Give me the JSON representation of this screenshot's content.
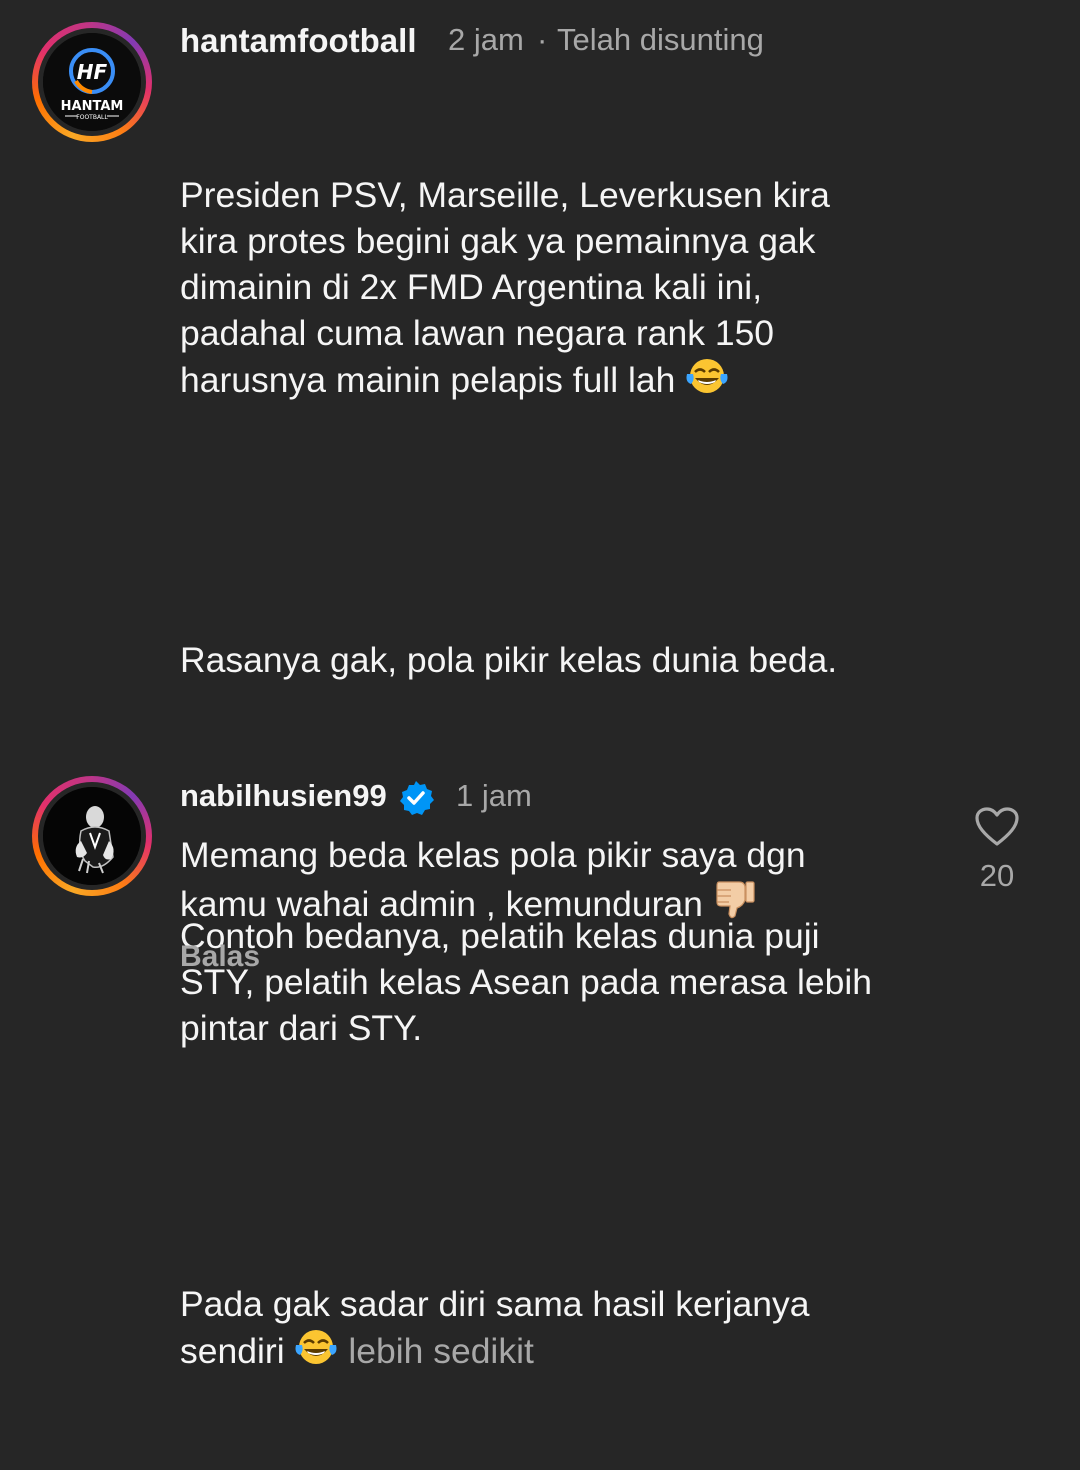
{
  "comments": [
    {
      "username": "hantamfootball",
      "time": "2 jam",
      "separator": "·",
      "edited": "Telah disunting",
      "avatar": {
        "logo_text": "HANTAM",
        "logo_subtext": "FOOTBALL",
        "logo_letters": "HF"
      },
      "paragraphs": [
        "Presiden PSV, Marseille, Leverkusen kira\nkira protes begini gak ya pemainnya gak\ndimainin di 2x FMD Argentina kali ini,\npadahal cuma lawan negara rank 150\nharusnya mainin pelapis full lah ",
        "Rasanya gak, pola pikir kelas dunia beda.",
        "Contoh bedanya, pelatih kelas dunia puji\nSTY, pelatih kelas Asean pada merasa lebih\npintar dari STY.",
        "Pada gak sadar diri sama hasil kerjanya\nsendiri "
      ],
      "emoji": "face-with-tears-of-joy",
      "more_label": "lebih sedikit"
    },
    {
      "username": "nabilhusien99",
      "verified": true,
      "time": "1 jam",
      "text": "Memang beda kelas pola pikir saya dgn\nkamu wahai admin , kemunduran ",
      "emoji": "thumbs-down",
      "like_count": "20",
      "reply_label": "Balas"
    }
  ],
  "colors": {
    "background": "#262626",
    "text": "#f5f5f5",
    "muted": "#a8a8a8",
    "verified": "#0095f6"
  }
}
